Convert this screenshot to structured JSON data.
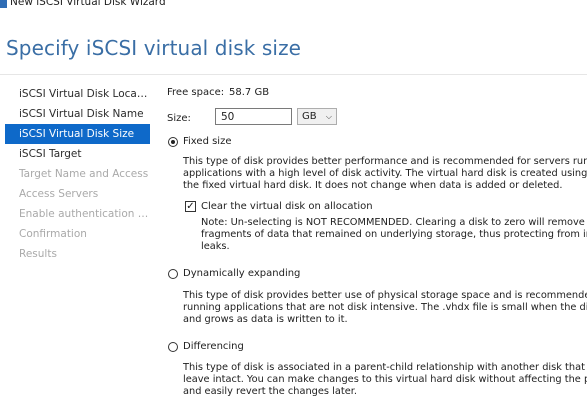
{
  "window": {
    "title": "New iSCSI Virtual Disk Wizard"
  },
  "page": {
    "heading": "Specify iSCSI virtual disk size"
  },
  "nav": {
    "items": [
      {
        "label": "iSCSI Virtual Disk Location",
        "state": "enabled"
      },
      {
        "label": "iSCSI Virtual Disk Name",
        "state": "enabled"
      },
      {
        "label": "iSCSI Virtual Disk Size",
        "state": "selected"
      },
      {
        "label": "iSCSI Target",
        "state": "enabled"
      },
      {
        "label": "Target Name and Access",
        "state": "disabled"
      },
      {
        "label": "Access Servers",
        "state": "disabled"
      },
      {
        "label": "Enable authentication ser...",
        "state": "disabled"
      },
      {
        "label": "Confirmation",
        "state": "disabled"
      },
      {
        "label": "Results",
        "state": "disabled"
      }
    ]
  },
  "form": {
    "free_space_label": "Free space:",
    "free_space_value": "58.7 GB",
    "size_label": "Size:",
    "size_value": "50",
    "unit_value": "GB",
    "options": {
      "fixed": {
        "label": "Fixed size",
        "checked": true,
        "desc": [
          "This type of disk provides better performance and is recommended for servers running",
          "applications with a high level of disk activity. The virtual hard disk is created using the size of",
          "the fixed virtual hard disk. It does not change when data is added or deleted."
        ],
        "clear_label": "Clear the virtual disk on allocation",
        "clear_checked": true,
        "note": [
          "Note: Un-selecting is NOT RECOMMENDED. Clearing a disk to zero will remove any",
          "fragments of data that remained on underlying storage, thus protecting from information",
          "leaks."
        ]
      },
      "dynamic": {
        "label": "Dynamically expanding",
        "checked": false,
        "desc": [
          "This type of disk provides better use of physical storage space and is recommended for servers",
          "running applications that are not disk intensive. The .vhdx file is small when the disk is created",
          "and grows as data is written to it."
        ]
      },
      "differencing": {
        "label": "Differencing",
        "checked": false,
        "desc": [
          "This type of disk is associated in a parent-child relationship with another disk that you want to",
          "leave intact. You can make changes to this virtual hard disk without affecting the parent disk",
          "and easily revert the changes later."
        ]
      }
    }
  }
}
